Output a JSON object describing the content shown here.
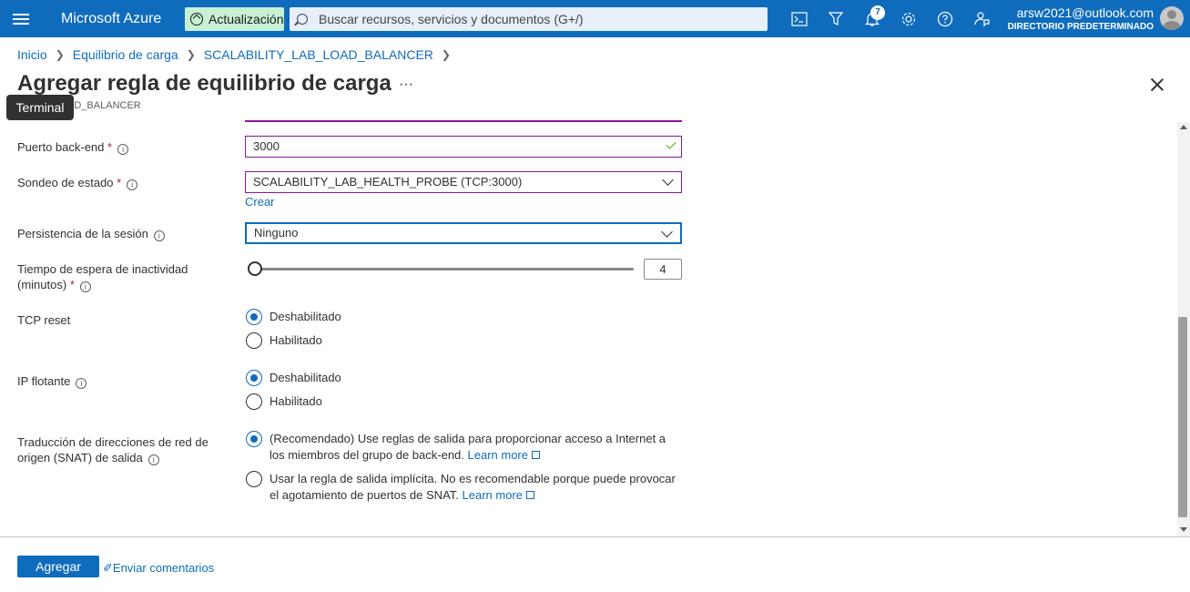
{
  "topbar": {
    "brand": "Microsoft Azure",
    "update_label": "Actualización",
    "search_placeholder": "Buscar recursos, servicios y documentos (G+/)",
    "notification_count": "7",
    "account_email": "arsw2021@outlook.com",
    "account_directory": "DIRECTORIO PREDETERMINADO",
    "accent_color": "#0f6cbd"
  },
  "breadcrumb": [
    "Inicio",
    "Equilibrio de carga",
    "SCALABILITY_LAB_LOAD_BALANCER"
  ],
  "panel": {
    "title": "Agregar regla de equilibrio de carga",
    "more": "···",
    "subtitle": "Y_LAB_LOAD_BALANCER",
    "tooltip": "Terminal"
  },
  "form": {
    "backend_port_label": "Puerto back-end",
    "backend_port_value": "3000",
    "health_probe_label": "Sondeo de estado",
    "health_probe_value": "SCALABILITY_LAB_HEALTH_PROBE (TCP:3000)",
    "create_link": "Crear",
    "session_label": "Persistencia de la sesión",
    "session_value": "Ninguno",
    "idle_label_1": "Tiempo de espera de inactividad",
    "idle_label_2": "(minutos)",
    "idle_value": "4",
    "tcp_reset_label": "TCP reset",
    "floating_ip_label": "IP flotante",
    "disabled": "Deshabilitado",
    "enabled": "Habilitado",
    "snat_label_1": "Traducción de direcciones de red de",
    "snat_label_2": "origen (SNAT) de salida",
    "snat_option_1": "(Recomendado) Use reglas de salida para proporcionar acceso a Internet a los miembros del grupo de back-end.",
    "snat_option_2": "Usar la regla de salida implícita. No es recomendable porque puede provocar el agotamiento de puertos de SNAT.",
    "learn_more": "Learn more",
    "required_mark": "*",
    "info_glyph": "i"
  },
  "footer": {
    "add_button": "Agregar",
    "feedback_link": "Enviar comentarios"
  }
}
